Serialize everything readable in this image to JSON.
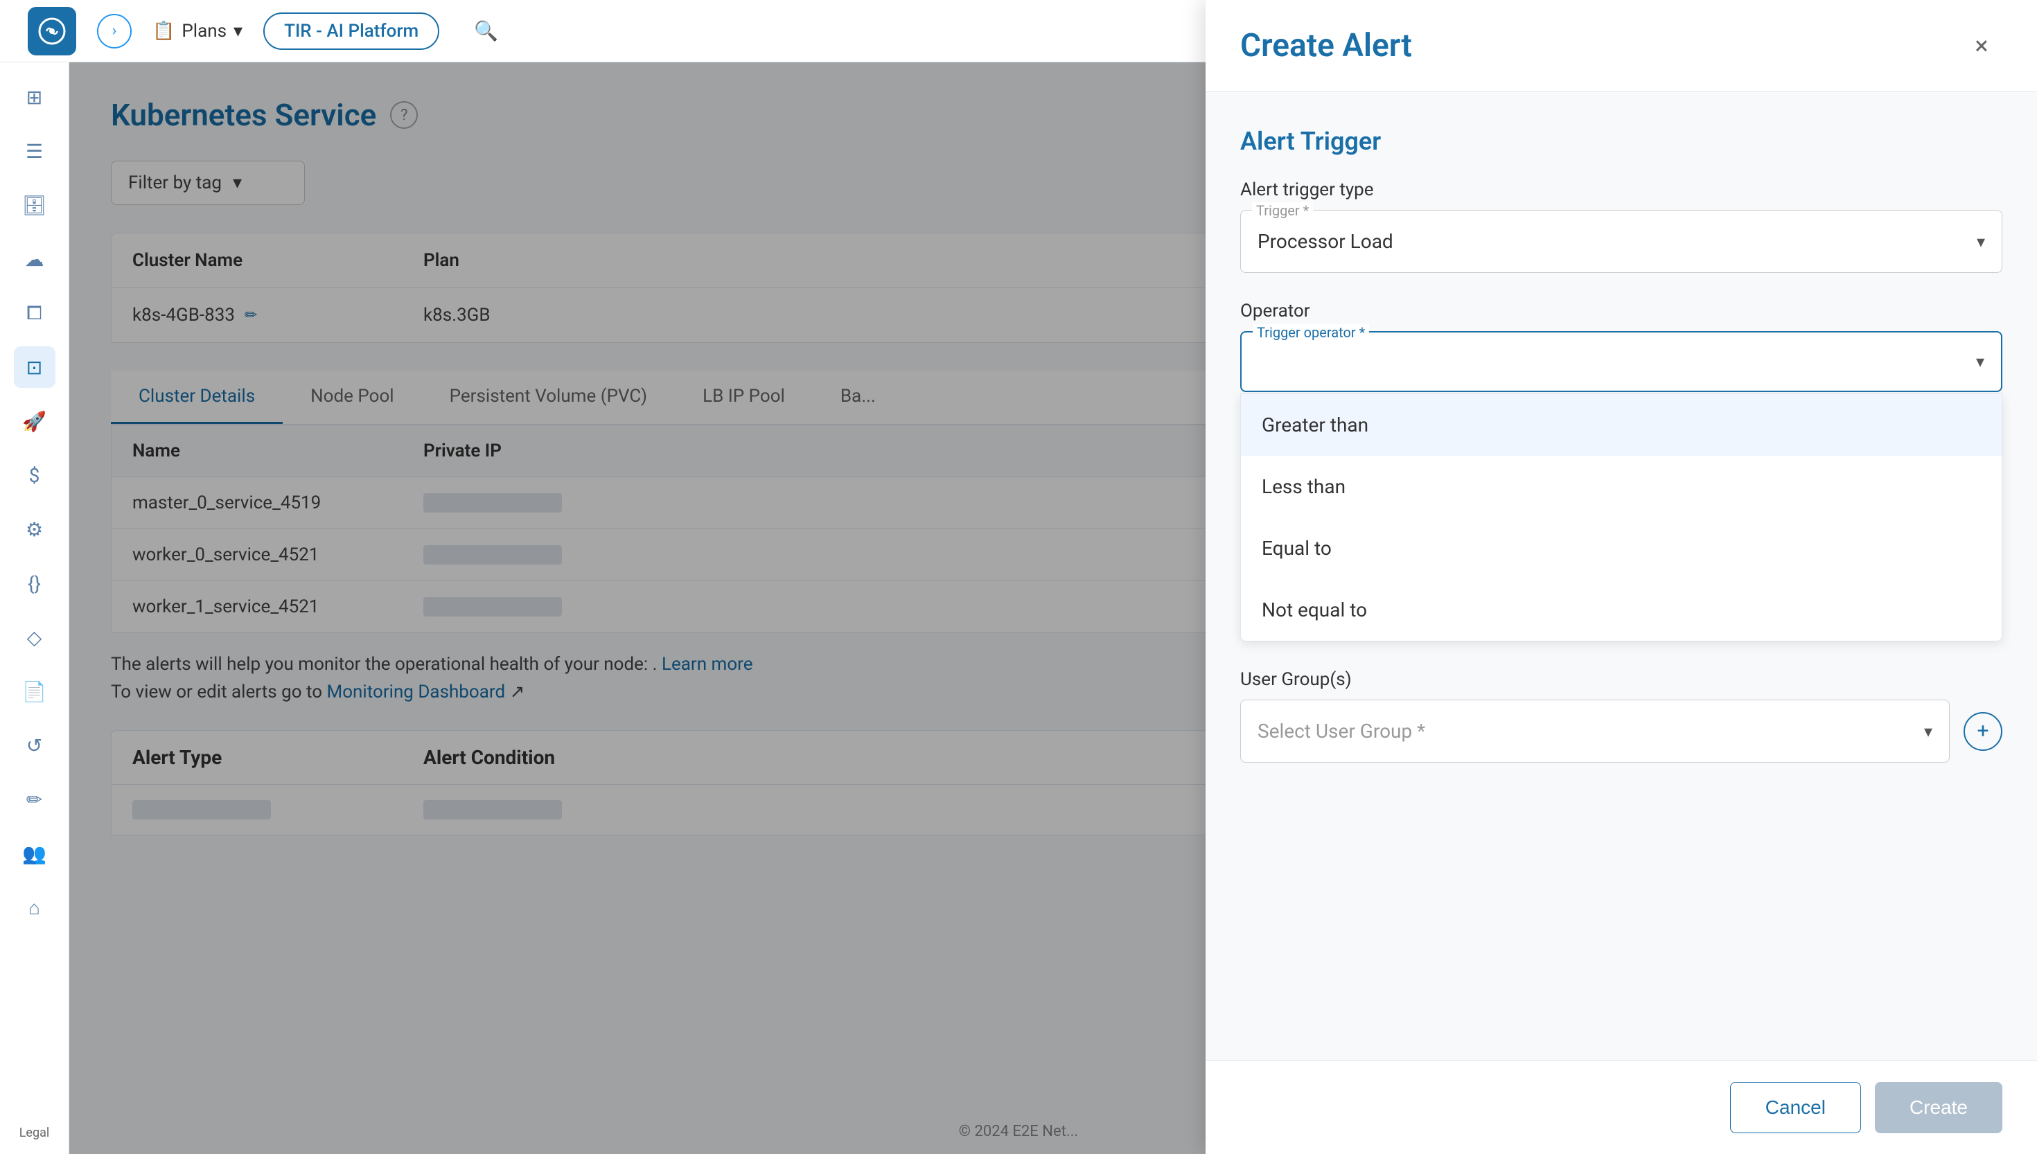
{
  "topbar": {
    "logo_icon": "cloud-icon",
    "arrow_icon": "›",
    "plans_label": "Plans",
    "platform_badge": "TIR - AI Platform",
    "search_icon": "🔍",
    "folder_icon": "📁"
  },
  "sidebar": {
    "items": [
      {
        "name": "grid-icon",
        "icon": "⊞",
        "active": false
      },
      {
        "name": "table-icon",
        "icon": "☰",
        "active": false
      },
      {
        "name": "database-icon",
        "icon": "🗄",
        "active": false
      },
      {
        "name": "cloud-upload-icon",
        "icon": "☁",
        "active": false
      },
      {
        "name": "layers-icon",
        "icon": "⧠",
        "active": false
      },
      {
        "name": "grid2-icon",
        "icon": "⊡",
        "active": false
      },
      {
        "name": "rocket-icon",
        "icon": "🚀",
        "active": false
      },
      {
        "name": "dollar-icon",
        "icon": "$",
        "active": false
      },
      {
        "name": "settings-icon",
        "icon": "⚙",
        "active": false
      },
      {
        "name": "code-icon",
        "icon": "{}",
        "active": false
      },
      {
        "name": "diamond-icon",
        "icon": "◇",
        "active": false
      },
      {
        "name": "file-icon",
        "icon": "📄",
        "active": false
      },
      {
        "name": "refresh-icon",
        "icon": "↺",
        "active": false
      },
      {
        "name": "edit2-icon",
        "icon": "✏",
        "active": false
      },
      {
        "name": "people-icon",
        "icon": "👥",
        "active": false
      },
      {
        "name": "home-icon",
        "icon": "⌂",
        "active": false
      }
    ],
    "legal_label": "Legal"
  },
  "main": {
    "page_title": "Kubernetes Service",
    "filter_placeholder": "Filter by tag",
    "table": {
      "headers": [
        "Cluster Name",
        "Plan",
        ""
      ],
      "rows": [
        {
          "name": "k8s-4GB-833",
          "plan": "k8s.3GB"
        }
      ]
    },
    "detail_tabs": [
      "Cluster Details",
      "Node Pool",
      "Persistent Volume (PVC)",
      "LB IP Pool",
      "Ba..."
    ],
    "inner_table": {
      "headers": [
        "Name",
        "Private IP",
        ""
      ],
      "rows": [
        {
          "name": "master_0_service_4519"
        },
        {
          "name": "worker_0_service_4521"
        },
        {
          "name": "worker_1_service_4521"
        }
      ]
    },
    "alert_info": "The alerts will help you monitor the operational health of your node: .",
    "learn_more": "Learn more",
    "monitoring_text": "To view or edit alerts go to",
    "monitoring_link": "Monitoring Dashboard",
    "alert_table": {
      "headers": [
        "Alert Type",
        "Alert Condition",
        ""
      ]
    }
  },
  "modal": {
    "title": "Create Alert",
    "close_icon": "×",
    "section_title": "Alert Trigger",
    "trigger_field": {
      "label": "Alert trigger type",
      "float_label": "Trigger *",
      "value": "Processor Load"
    },
    "operator_field": {
      "label": "Operator",
      "float_label": "Trigger operator *",
      "value": "",
      "options": [
        {
          "label": "Greater than",
          "highlighted": true
        },
        {
          "label": "Less than",
          "highlighted": false
        },
        {
          "label": "Equal to",
          "highlighted": false
        },
        {
          "label": "Not equal to",
          "highlighted": false
        }
      ]
    },
    "user_group_field": {
      "label": "User Group(s)",
      "placeholder": "Select User Group *",
      "add_icon": "+"
    },
    "buttons": {
      "cancel": "Cancel",
      "create": "Create"
    }
  },
  "footer": {
    "copyright": "© 2024 E2E Net..."
  }
}
